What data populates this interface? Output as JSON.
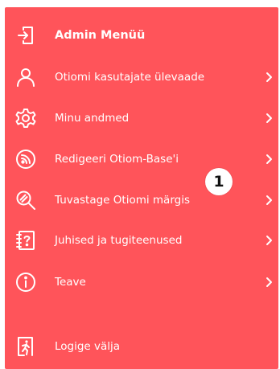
{
  "menu": {
    "title": "Admin Menüü",
    "title_icon": "login-icon",
    "items": [
      {
        "label": "Otiomi kasutajate ülevaade",
        "icon": "user-icon"
      },
      {
        "label": "Minu andmed",
        "icon": "gear-icon"
      },
      {
        "label": "Redigeeri Otiom-Base'i",
        "icon": "rss-icon"
      },
      {
        "label": "Tuvastage Otiomi märgis",
        "icon": "search-tag-icon"
      },
      {
        "label": "Juhised ja tugiteenused",
        "icon": "help-book-icon"
      },
      {
        "label": "Teave",
        "icon": "info-icon"
      }
    ],
    "logout": {
      "label": "Logige välja",
      "icon": "exit-icon"
    }
  },
  "overlay": {
    "marker_number": "1"
  },
  "colors": {
    "background": "#ff545a",
    "text": "#ffffff"
  }
}
